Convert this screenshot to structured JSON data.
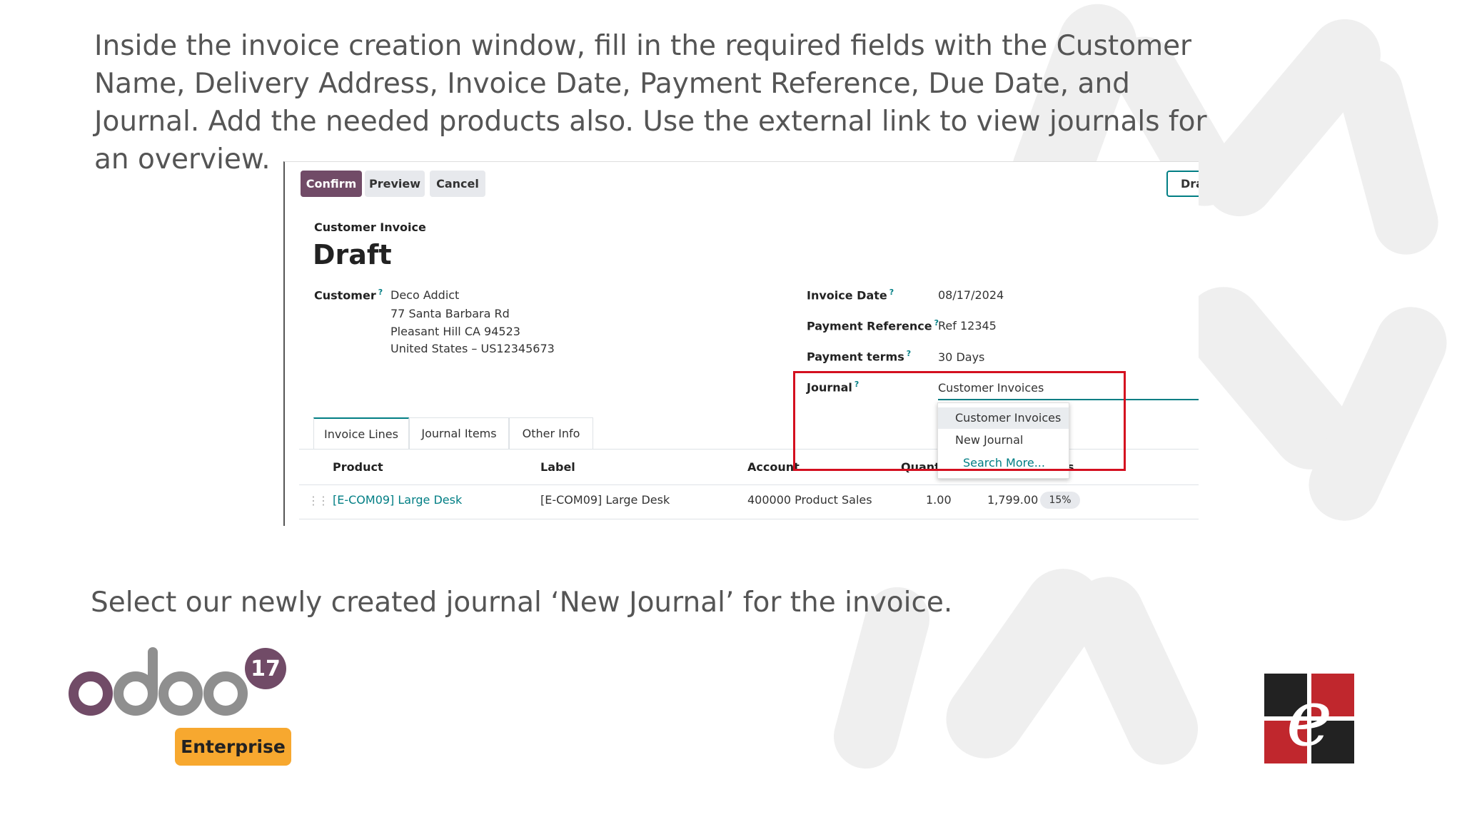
{
  "slide": {
    "intro_text": "Inside the invoice creation window, fill in the required fields with the Customer Name, Delivery Address, Invoice Date, Payment Reference, Due Date, and Journal. Add the needed products also. Use the external link to view journals for an overview.",
    "outro_text": "Select our newly created journal ‘New Journal’ for the invoice."
  },
  "toolbar": {
    "confirm_label": "Confirm",
    "preview_label": "Preview",
    "cancel_label": "Cancel",
    "draft_label": "Dra"
  },
  "invoice": {
    "doc_type": "Customer Invoice",
    "status": "Draft",
    "customer_label": "Customer",
    "customer_name": "Deco Addict",
    "address_line1": "77 Santa Barbara Rd",
    "address_line2": "Pleasant Hill CA 94523",
    "address_line3": "United States – US12345673",
    "invoice_date_label": "Invoice Date",
    "invoice_date": "08/17/2024",
    "payment_ref_label": "Payment Reference",
    "payment_ref": "Ref 12345",
    "payment_terms_label": "Payment terms",
    "payment_terms": "30 Days",
    "journal_label": "Journal",
    "journal_value": "Customer Invoices",
    "help_mark": "?"
  },
  "journal_dropdown": {
    "options": [
      "Customer Invoices",
      "New Journal"
    ],
    "search_more": "Search More..."
  },
  "tabs": [
    "Invoice Lines",
    "Journal Items",
    "Other Info"
  ],
  "lines": {
    "headers": {
      "product": "Product",
      "label": "Label",
      "account": "Account",
      "quantity": "Quant",
      "extra": "s"
    },
    "rows": [
      {
        "product": "[E-COM09] Large Desk",
        "label": "[E-COM09] Large Desk",
        "account": "400000 Product Sales",
        "quantity": "1.00",
        "price": "1,799.00",
        "tax": "15%"
      }
    ]
  },
  "branding": {
    "logo_text": "odoo",
    "version": "17",
    "edition": "Enterprise",
    "accent": "#714b67",
    "brand_red": "#c0272d"
  }
}
